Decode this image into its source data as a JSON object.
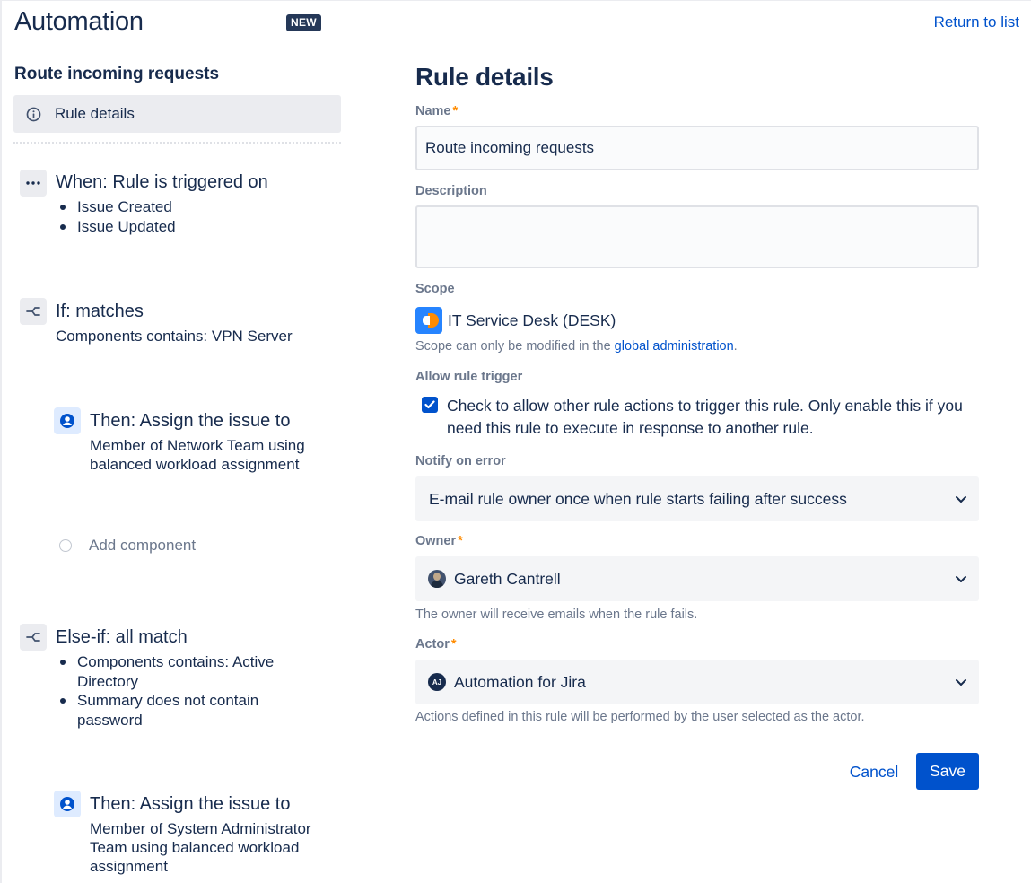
{
  "app": {
    "title": "Automation",
    "badge": "NEW"
  },
  "sidebar": {
    "rule_name": "Route incoming requests",
    "selected_item": "Rule details",
    "components": [
      {
        "kind": "trigger",
        "icon": "more-dots-icon",
        "title": "When: Rule is triggered on",
        "bullets": [
          "Issue Created",
          "Issue Updated"
        ]
      },
      {
        "kind": "condition",
        "icon": "branch-icon",
        "title": "If: matches",
        "lines": [
          "Components contains: VPN Server"
        ]
      },
      {
        "kind": "action",
        "icon": "user-icon",
        "title": "Then: Assign the issue to",
        "lines": [
          "Member of Network Team using",
          "balanced workload assignment"
        ]
      },
      {
        "kind": "add",
        "label": "Add component"
      },
      {
        "kind": "condition",
        "icon": "branch-icon",
        "title": "Else-if: all match",
        "bullets": [
          "Components contains: Active Directory",
          "Summary does not contain password"
        ]
      },
      {
        "kind": "action",
        "icon": "user-icon",
        "title": "Then: Assign the issue to",
        "lines": [
          "Member of System Administrator",
          "Team using balanced workload",
          "assignment"
        ]
      }
    ]
  },
  "header": {
    "return_link": "Return to list"
  },
  "form": {
    "title": "Rule details",
    "name": {
      "label": "Name",
      "value": "Route incoming requests",
      "required": true
    },
    "description": {
      "label": "Description",
      "value": ""
    },
    "scope": {
      "label": "Scope",
      "value": "IT Service Desk (DESK)",
      "helper_prefix": "Scope can only be modified in the ",
      "helper_link": "global administration",
      "helper_suffix": "."
    },
    "allow_trigger": {
      "label": "Allow rule trigger",
      "checked": true,
      "text": "Check to allow other rule actions to trigger this rule. Only enable this if you need this rule to execute in response to another rule."
    },
    "notify": {
      "label": "Notify on error",
      "value": "E-mail rule owner once when rule starts failing after success"
    },
    "owner": {
      "label": "Owner",
      "value": "Gareth Cantrell",
      "required": true,
      "helper": "The owner will receive emails when the rule fails."
    },
    "actor": {
      "label": "Actor",
      "value": "Automation for Jira",
      "avatar_text": "AJ",
      "required": true,
      "helper": "Actions defined in this rule will be performed by the user selected as the actor."
    },
    "cancel_label": "Cancel",
    "save_label": "Save"
  },
  "colors": {
    "primary": "#0052cc",
    "required": "#ff8b00",
    "text": "#172b4d",
    "subtle": "#6b778c",
    "badge": "#253858"
  }
}
